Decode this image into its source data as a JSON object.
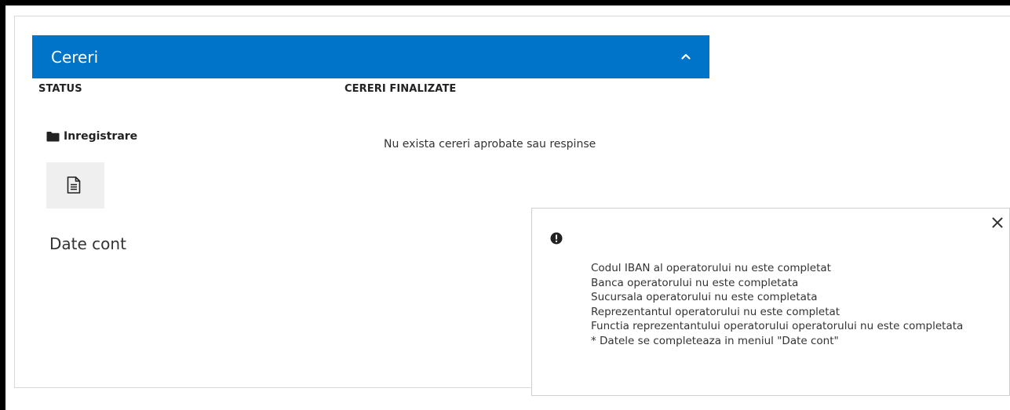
{
  "panel": {
    "title": "Cereri",
    "columns": {
      "status": "STATUS",
      "finalized": "CERERI FINALIZATE"
    },
    "folder": {
      "icon": "folder-icon",
      "label": "Inregistrare"
    },
    "document": {
      "icon": "document-icon",
      "label": "Date cont"
    },
    "empty_message": "Nu exista cereri aprobate sau respinse",
    "header_color": "#0074c8"
  },
  "notification": {
    "icon": "exclamation-circle-icon",
    "close_icon": "close-icon",
    "messages": [
      "Codul IBAN al operatorului nu este completat",
      "Banca operatorului nu este completata",
      "Sucursala operatorului nu este completata",
      "Reprezentantul operatorului nu este completat",
      "Functia reprezentantului operatorului operatorului nu este completata",
      "* Datele se completeaza in meniul \"Date cont\""
    ]
  }
}
